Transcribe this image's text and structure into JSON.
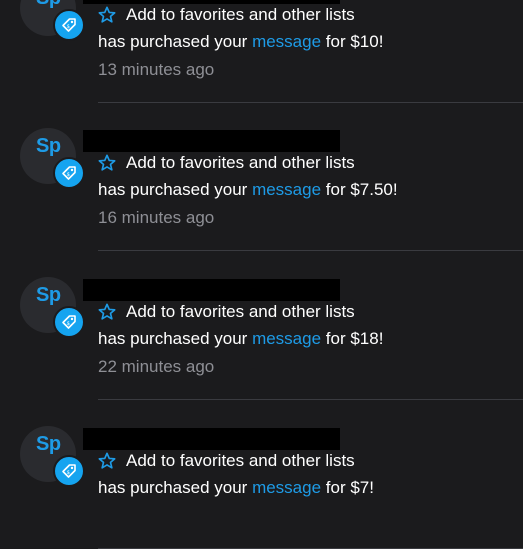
{
  "notifications": [
    {
      "avatar_initials": "Sp",
      "favorites_label": "Add to favorites and other lists",
      "action_text": "has purchased your",
      "link_text": "message",
      "amount_text": "for $10!",
      "time": "13 minutes ago"
    },
    {
      "avatar_initials": "Sp",
      "favorites_label": "Add to favorites and other lists",
      "action_text": "has purchased your",
      "link_text": "message",
      "amount_text": "for $7.50!",
      "time": "16 minutes ago"
    },
    {
      "avatar_initials": "Sp",
      "favorites_label": "Add to favorites and other lists",
      "action_text": "has purchased your",
      "link_text": "message",
      "amount_text": "for $18!",
      "time": "22 minutes ago"
    },
    {
      "avatar_initials": "Sp",
      "favorites_label": "Add to favorites and other lists",
      "action_text": "has purchased your",
      "link_text": "message",
      "amount_text": "for $7!",
      "time": ""
    }
  ],
  "colors": {
    "background": "#1b1b1d",
    "accent": "#1e9be6",
    "badge": "#15a4f0",
    "timestamp": "#8e8f95",
    "divider": "#3a3b40"
  },
  "icons": {
    "favorite": "star-outline-icon",
    "badge": "price-tag-icon"
  }
}
